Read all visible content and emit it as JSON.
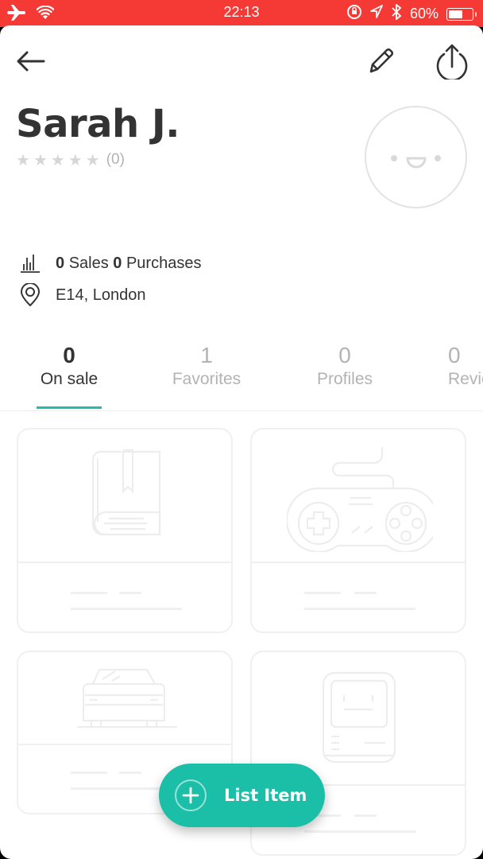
{
  "status_bar": {
    "time": "22:13",
    "battery_text": "60%",
    "battery_level": 0.6,
    "icons": [
      "airplane-icon",
      "wifi-icon",
      "rotation-lock-icon",
      "location-arrow-icon",
      "bluetooth-icon",
      "battery-icon"
    ]
  },
  "header": {
    "back_icon": "arrow-left-icon",
    "edit_icon": "pencil-icon",
    "share_icon": "share-icon"
  },
  "profile": {
    "name": "Sarah J.",
    "rating_stars": 0,
    "rating_max": 5,
    "rating_count": "(0)",
    "sales_count": "0",
    "sales_label": "Sales",
    "purchases_count": "0",
    "purchases_label": "Purchases",
    "location": "E14, London"
  },
  "tabs": [
    {
      "count": "0",
      "label": "On sale",
      "active": true
    },
    {
      "count": "1",
      "label": "Favorites",
      "active": false
    },
    {
      "count": "0",
      "label": "Profiles",
      "active": false
    },
    {
      "count": "0",
      "label": "Reviews",
      "active": false
    }
  ],
  "placeholder_cards": [
    {
      "icon": "book-icon"
    },
    {
      "icon": "gamepad-icon"
    },
    {
      "icon": "car-icon"
    },
    {
      "icon": "computer-icon"
    }
  ],
  "fab": {
    "label": "List Item",
    "icon": "plus-circle-icon"
  },
  "colors": {
    "status_bar": "#f53a36",
    "accent": "#1bbfa8",
    "text_primary": "#333333",
    "text_muted": "#b3b3b3"
  }
}
